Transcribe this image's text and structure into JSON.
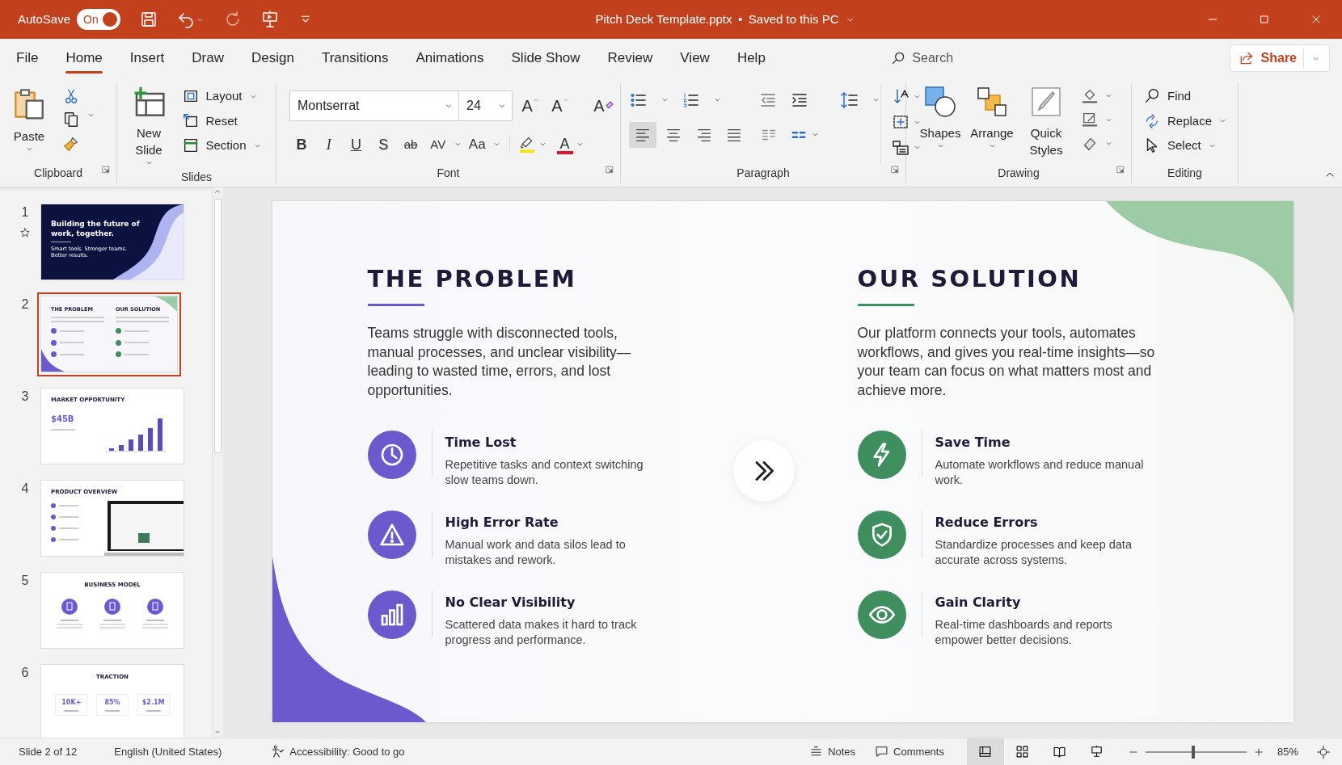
{
  "title_bar": {
    "autosave_label": "AutoSave",
    "autosave": {
      "on": true,
      "text": "On"
    },
    "title": "Pitch Deck Template.pptx",
    "separator": "•",
    "save_status": "Saved to this PC"
  },
  "menu_tabs": [
    {
      "label": "File",
      "selected": false
    },
    {
      "label": "Home",
      "selected": true
    },
    {
      "label": "Insert",
      "selected": false
    },
    {
      "label": "Draw",
      "selected": false
    },
    {
      "label": "Design",
      "selected": false
    },
    {
      "label": "Transitions",
      "selected": false
    },
    {
      "label": "Animations",
      "selected": false
    },
    {
      "label": "Slide Show",
      "selected": false
    },
    {
      "label": "Review",
      "selected": false
    },
    {
      "label": "View",
      "selected": false
    },
    {
      "label": "Help",
      "selected": false
    }
  ],
  "search": {
    "placeholder": "Search"
  },
  "share_button": "Share",
  "ribbon_groups": [
    {
      "kind": "clipboard",
      "label": "Clipboard",
      "paste": "Paste"
    },
    {
      "kind": "slides",
      "label": "Slides",
      "new_slide": "New Slide",
      "buttons": [
        "Layout",
        "Reset",
        "Section"
      ]
    },
    {
      "kind": "font",
      "label": "Font",
      "font_name": "Montserrat",
      "font_size": "24",
      "size_buttons": [
        {
          "kind": "grow",
          "text": "A"
        },
        {
          "kind": "shrink",
          "text": "A"
        }
      ],
      "clear_format": "A",
      "format_buttons": [
        {
          "kind": "bold",
          "text": "B"
        },
        {
          "kind": "italic",
          "text": "I"
        },
        {
          "kind": "underline",
          "text": "U"
        },
        {
          "kind": "shadow",
          "text": "S"
        },
        {
          "kind": "strike",
          "text": "ab"
        },
        {
          "kind": "spacing",
          "text": "AV"
        },
        {
          "kind": "case",
          "text": "Aa"
        }
      ],
      "font_color": "A"
    },
    {
      "kind": "paragraph",
      "label": "Paragraph",
      "alignments": [
        {
          "kind": "left",
          "selected": true
        },
        {
          "kind": "center",
          "selected": false
        },
        {
          "kind": "right",
          "selected": false
        },
        {
          "kind": "justify",
          "selected": false
        }
      ]
    },
    {
      "kind": "drawing",
      "label": "Drawing",
      "buttons": [
        "Shapes",
        "Arrange",
        "Quick Styles"
      ]
    },
    {
      "kind": "editing",
      "label": "Editing",
      "buttons": [
        "Find",
        "Replace",
        "Select"
      ]
    }
  ],
  "thumbnails": [
    {
      "number": "1",
      "starred": true,
      "selected": false,
      "kind": "title",
      "heading": "Building the future of work, together.",
      "subtitle": "Smart tools. Stronger teams. Better results."
    },
    {
      "number": "2",
      "starred": false,
      "selected": true,
      "kind": "two_column",
      "headings": [
        "THE PROBLEM",
        "OUR SOLUTION"
      ]
    },
    {
      "number": "3",
      "starred": false,
      "selected": false,
      "kind": "chart",
      "heading": "MARKET OPPORTUNITY",
      "stat": "$45B"
    },
    {
      "number": "4",
      "starred": false,
      "selected": false,
      "kind": "product",
      "heading": "PRODUCT OVERVIEW"
    },
    {
      "number": "5",
      "starred": false,
      "selected": false,
      "kind": "cards",
      "heading": "BUSINESS MODEL"
    },
    {
      "number": "6",
      "starred": false,
      "selected": false,
      "kind": "stats",
      "heading": "TRACTION",
      "stats": [
        "10K+",
        "85%",
        "$2.1M"
      ]
    }
  ],
  "slide": {
    "columns": [
      {
        "title": "THE PROBLEM",
        "color": "#6a5acd",
        "intro": "Teams struggle with disconnected tools, manual processes, and unclear visibility—leading to wasted time, errors, and lost opportunities.",
        "items": [
          {
            "title": "Time Lost",
            "description": "Repetitive tasks and context switching slow teams down."
          },
          {
            "title": "High Error Rate",
            "description": "Manual work and data silos lead to mistakes and rework."
          },
          {
            "title": "No Clear Visibility",
            "description": "Scattered data makes it hard to track progress and performance."
          }
        ]
      },
      {
        "title": "OUR SOLUTION",
        "color": "#3e8e5e",
        "intro": "Our platform connects your tools, automates workflows, and gives you real-time insights—so your team can focus on what matters most and achieve more.",
        "items": [
          {
            "title": "Save Time",
            "description": "Automate workflows and reduce manual work."
          },
          {
            "title": "Reduce Errors",
            "description": "Standardize processes and keep data accurate across systems."
          },
          {
            "title": "Gain Clarity",
            "description": "Real-time dashboards and reports empower better decisions."
          }
        ]
      }
    ]
  },
  "status_bar": {
    "slide_indicator": "Slide 2 of 12",
    "language": "English (United States)",
    "accessibility": "Accessibility: Good to go",
    "notes": "Notes",
    "comments": "Comments",
    "view_buttons": [
      {
        "kind": "normal",
        "selected": true
      },
      {
        "kind": "sorter",
        "selected": false
      },
      {
        "kind": "reading",
        "selected": false
      },
      {
        "kind": "slideshow",
        "selected": false
      }
    ],
    "zoom": {
      "level": 0.47,
      "text": "85%"
    }
  }
}
